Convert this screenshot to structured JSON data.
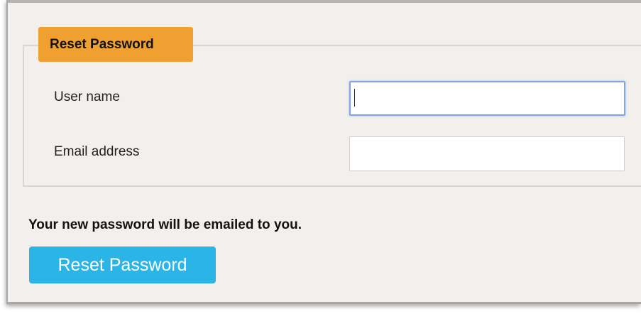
{
  "form": {
    "legend": "Reset Password",
    "fields": [
      {
        "label": "User name",
        "value": "",
        "placeholder": ""
      },
      {
        "label": "Email address",
        "value": "",
        "placeholder": ""
      }
    ],
    "note": "Your new password will be emailed to you.",
    "submit_label": "Reset Password"
  }
}
